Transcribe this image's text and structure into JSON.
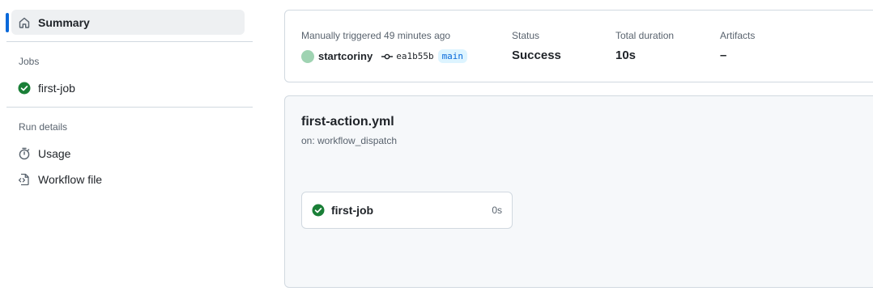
{
  "sidebar": {
    "summary_label": "Summary",
    "jobs_heading": "Jobs",
    "jobs": [
      {
        "label": "first-job",
        "status": "success"
      }
    ],
    "run_details_heading": "Run details",
    "run_details": [
      {
        "label": "Usage",
        "icon": "stopwatch-icon"
      },
      {
        "label": "Workflow file",
        "icon": "file-code-icon"
      }
    ]
  },
  "summary": {
    "trigger_label": "Manually triggered 49 minutes ago",
    "actor": "startcoriny",
    "commit_sha": "ea1b55b",
    "branch": "main",
    "status_label": "Status",
    "status_value": "Success",
    "duration_label": "Total duration",
    "duration_value": "10s",
    "artifacts_label": "Artifacts",
    "artifacts_value": "–"
  },
  "workflow": {
    "title": "first-action.yml",
    "trigger": "on: workflow_dispatch",
    "job": {
      "name": "first-job",
      "duration": "0s"
    }
  },
  "colors": {
    "accent": "#0969da",
    "success": "#1a7f37",
    "muted": "#59636e",
    "border": "#d1d9e0"
  }
}
